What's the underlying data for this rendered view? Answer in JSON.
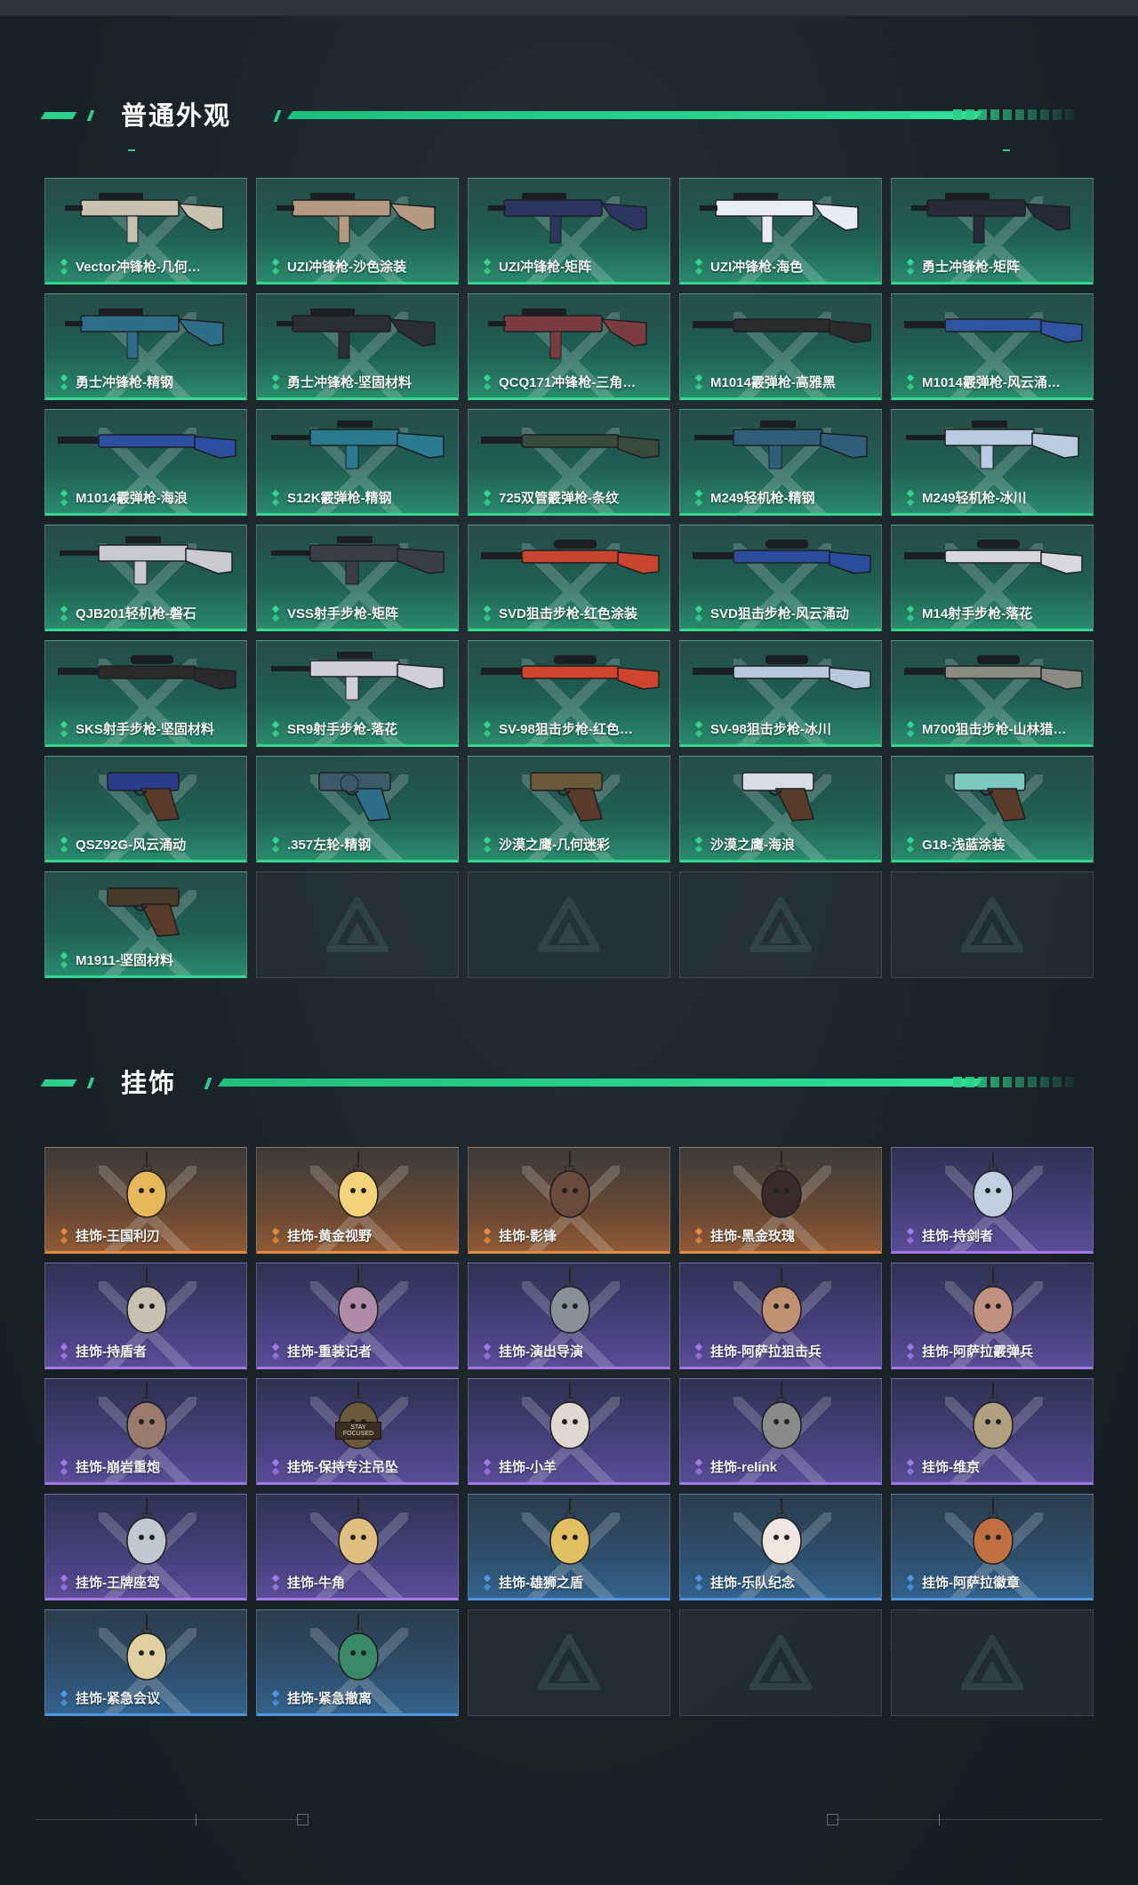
{
  "sections": {
    "skins": {
      "title": "普通外观"
    },
    "charms": {
      "title": "挂饰"
    }
  },
  "colors": {
    "accent": "#2bd08a",
    "rarity_green": "#35d68f",
    "rarity_orange": "#e58a3e",
    "rarity_purple": "#9f7ae8",
    "rarity_blue": "#4f95e4"
  },
  "skins": [
    {
      "label": "Vector冲锋枪-几何…",
      "rarity": "green",
      "kind": "smg"
    },
    {
      "label": "UZI冲锋枪-沙色涂装",
      "rarity": "green",
      "kind": "smg"
    },
    {
      "label": "UZI冲锋枪-矩阵",
      "rarity": "green",
      "kind": "smg"
    },
    {
      "label": "UZI冲锋枪-海色",
      "rarity": "green",
      "kind": "smg"
    },
    {
      "label": "勇士冲锋枪-矩阵",
      "rarity": "green",
      "kind": "smg"
    },
    {
      "label": "勇士冲锋枪-精钢",
      "rarity": "green",
      "kind": "smg"
    },
    {
      "label": "勇士冲锋枪-坚固材料",
      "rarity": "green",
      "kind": "smg"
    },
    {
      "label": "QCQ171冲锋枪-三角…",
      "rarity": "green",
      "kind": "smg"
    },
    {
      "label": "M1014霰弹枪-高雅黑",
      "rarity": "green",
      "kind": "shotgun"
    },
    {
      "label": "M1014霰弹枪-风云涌…",
      "rarity": "green",
      "kind": "shotgun"
    },
    {
      "label": "M1014霰弹枪-海浪",
      "rarity": "green",
      "kind": "shotgun"
    },
    {
      "label": "S12K霰弹枪-精钢",
      "rarity": "green",
      "kind": "rifle"
    },
    {
      "label": "725双管霰弹枪-条纹",
      "rarity": "green",
      "kind": "shotgun"
    },
    {
      "label": "M249轻机枪-精钢",
      "rarity": "green",
      "kind": "lmg"
    },
    {
      "label": "M249轻机枪-冰川",
      "rarity": "green",
      "kind": "lmg"
    },
    {
      "label": "QJB201轻机枪-磐石",
      "rarity": "green",
      "kind": "lmg"
    },
    {
      "label": "VSS射手步枪-矩阵",
      "rarity": "green",
      "kind": "rifle"
    },
    {
      "label": "SVD狙击步枪-红色涂装",
      "rarity": "green",
      "kind": "sniper"
    },
    {
      "label": "SVD狙击步枪-风云涌动",
      "rarity": "green",
      "kind": "sniper"
    },
    {
      "label": "M14射手步枪-落花",
      "rarity": "green",
      "kind": "sniper"
    },
    {
      "label": "SKS射手步枪-坚固材料",
      "rarity": "green",
      "kind": "sniper"
    },
    {
      "label": "SR9射手步枪-落花",
      "rarity": "green",
      "kind": "rifle"
    },
    {
      "label": "SV-98狙击步枪-红色…",
      "rarity": "green",
      "kind": "sniper"
    },
    {
      "label": "SV-98狙击步枪-冰川",
      "rarity": "green",
      "kind": "sniper"
    },
    {
      "label": "M700狙击步枪-山林猎…",
      "rarity": "green",
      "kind": "sniper"
    },
    {
      "label": "QSZ92G-风云涌动",
      "rarity": "green",
      "kind": "pistol"
    },
    {
      "label": ".357左轮-精钢",
      "rarity": "green",
      "kind": "revolver"
    },
    {
      "label": "沙漠之鹰-几何迷彩",
      "rarity": "green",
      "kind": "pistol"
    },
    {
      "label": "沙漠之鹰-海浪",
      "rarity": "green",
      "kind": "pistol"
    },
    {
      "label": "G18-浅蓝涂装",
      "rarity": "green",
      "kind": "pistol"
    },
    {
      "label": "M1911-坚固材料",
      "rarity": "green",
      "kind": "pistol"
    },
    {
      "label": "",
      "rarity": "empty"
    },
    {
      "label": "",
      "rarity": "empty"
    },
    {
      "label": "",
      "rarity": "empty"
    },
    {
      "label": "",
      "rarity": "empty"
    }
  ],
  "charms": [
    {
      "label": "挂饰-王国利刃",
      "rarity": "orange"
    },
    {
      "label": "挂饰-黄金视野",
      "rarity": "orange"
    },
    {
      "label": "挂饰-影锋",
      "rarity": "orange"
    },
    {
      "label": "挂饰-黑金玫瑰",
      "rarity": "orange"
    },
    {
      "label": "挂饰-持剑者",
      "rarity": "purple"
    },
    {
      "label": "挂饰-持盾者",
      "rarity": "purple"
    },
    {
      "label": "挂饰-重装记者",
      "rarity": "purple"
    },
    {
      "label": "挂饰-演出导演",
      "rarity": "purple"
    },
    {
      "label": "挂饰-阿萨拉狙击兵",
      "rarity": "purple"
    },
    {
      "label": "挂饰-阿萨拉霰弹兵",
      "rarity": "purple"
    },
    {
      "label": "挂饰-崩岩重炮",
      "rarity": "purple"
    },
    {
      "label": "挂饰-保持专注吊坠",
      "rarity": "purple",
      "tag": "STAY FOCUSED"
    },
    {
      "label": "挂饰-小羊",
      "rarity": "purple"
    },
    {
      "label": "挂饰-relink",
      "rarity": "purple"
    },
    {
      "label": "挂饰-维京",
      "rarity": "purple"
    },
    {
      "label": "挂饰-王牌座驾",
      "rarity": "purple"
    },
    {
      "label": "挂饰-牛角",
      "rarity": "purple"
    },
    {
      "label": "挂饰-雄狮之盾",
      "rarity": "blue"
    },
    {
      "label": "挂饰-乐队纪念",
      "rarity": "blue"
    },
    {
      "label": "挂饰-阿萨拉徽章",
      "rarity": "blue"
    },
    {
      "label": "挂饰-紧急会议",
      "rarity": "blue"
    },
    {
      "label": "挂饰-紧急撤离",
      "rarity": "blue"
    },
    {
      "label": "",
      "rarity": "empty"
    },
    {
      "label": "",
      "rarity": "empty"
    },
    {
      "label": "",
      "rarity": "empty"
    }
  ]
}
